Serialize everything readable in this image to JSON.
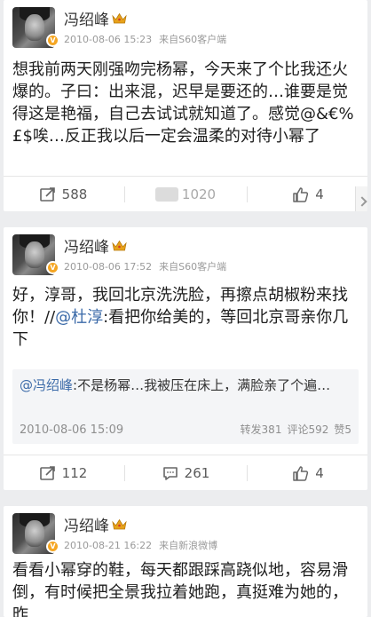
{
  "posts": [
    {
      "username": "冯绍峰",
      "meta": {
        "time": "2010-08-06 15:23",
        "source": "来自S60客户端"
      },
      "text": "想我前两天刚强吻完杨幂，今天来了个比我还火爆的。子曰：出来混，迟早是要还的…谁要是觉得这是艳福，自己去试试就知道了。感觉@&€%£$唉…反正我以后一定会温柔的对待小幂了",
      "actions": {
        "repost_count": "588",
        "comment_count": "1020",
        "like_count": "4"
      }
    },
    {
      "username": "冯绍峰",
      "meta": {
        "time": "2010-08-06 17:52",
        "source": "来自S60客户端"
      },
      "text_parts": {
        "before": "好，淳哥，我回北京洗洗脸，再擦点胡椒粉来找你！//",
        "mention": "@杜淳",
        "after": ":看把你给美的，等回北京哥亲你几下"
      },
      "repost": {
        "mention": "@冯绍峰",
        "text": ":不是杨幂…我被压在床上，满脸亲了个遍…",
        "time": "2010-08-06 15:09",
        "reposts": "转发381",
        "comments": "评论592",
        "likes": "赞5"
      },
      "actions": {
        "repost_count": "112",
        "comment_count": "261",
        "like_count": "4"
      }
    },
    {
      "username": "冯绍峰",
      "meta": {
        "time": "2010-08-21 16:22",
        "source": "来自新浪微博"
      },
      "text": "看看小幂穿的鞋，每天都跟踩高跷似地，容易滑倒，有时候把全景我拉着她跑，真挺难为她的，昨"
    }
  ],
  "colors": {
    "accent": "#3b6aa8",
    "badge": "#f5a623",
    "crown": "#e8a21a"
  }
}
